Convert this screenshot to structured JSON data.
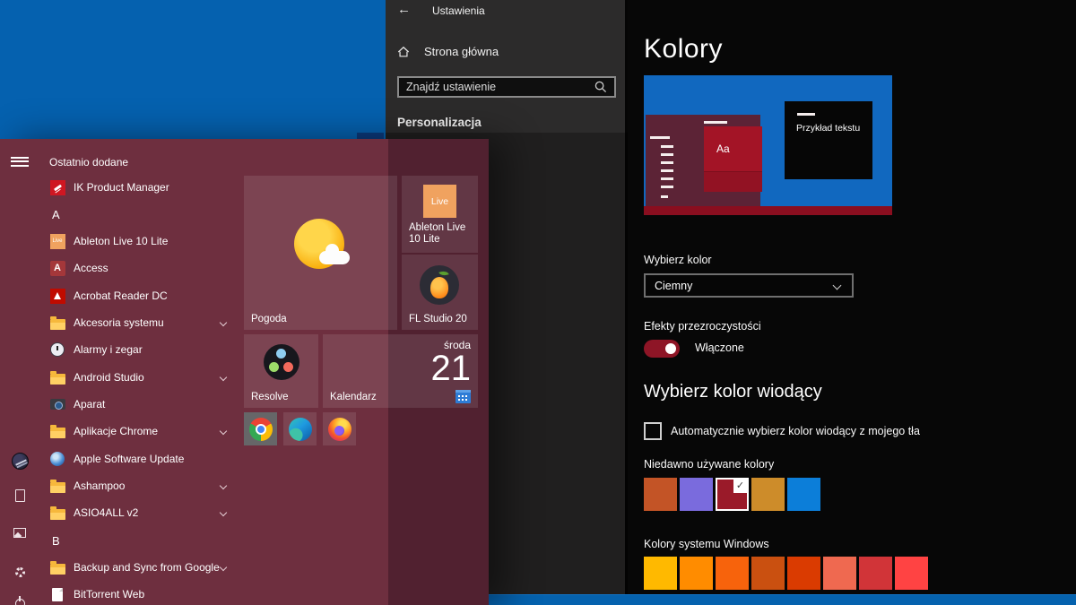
{
  "desktop": {
    "wallpaper_color": "#0561af",
    "taskbar_color": "#0562ae"
  },
  "settings_sidebar": {
    "back_arrow": "←",
    "title": "Ustawienia",
    "home_label": "Strona główna",
    "search_placeholder": "Znajdź ustawienie",
    "section_header": "Personalizacja"
  },
  "colors_page": {
    "title": "Kolory",
    "preview": {
      "aa": "Aa",
      "sample_text": "Przykład tekstu"
    },
    "choose_color_label": "Wybierz kolor",
    "choose_color_value": "Ciemny",
    "transparency_label": "Efekty przezroczystości",
    "transparency_state": "Włączone",
    "accent_header": "Wybierz kolor wiodący",
    "auto_checkbox_label": "Automatycznie wybierz kolor wiodący z mojego tła",
    "recent_colors_label": "Niedawno używane kolory",
    "recent_colors": [
      "#c35426",
      "#7a6bdd",
      "#9a1a29",
      "#cd8c2a",
      "#0c7ed9"
    ],
    "selected_recent_index": 2,
    "system_colors_label": "Kolory systemu Windows",
    "system_colors": [
      "#ffb900",
      "#ff8c00",
      "#f7630c",
      "#ca5010",
      "#da3b01",
      "#ef6950",
      "#d13438",
      "#ff4343"
    ],
    "accent_color": "#8e1526"
  },
  "start_menu": {
    "recent_header": "Ostatnio dodane",
    "apps": [
      {
        "label": "IK Product Manager"
      },
      {
        "label": "A"
      },
      {
        "label": "Ableton Live 10 Lite"
      },
      {
        "label": "Access"
      },
      {
        "label": "Acrobat Reader DC"
      },
      {
        "label": "Akcesoria systemu"
      },
      {
        "label": "Alarmy i zegar"
      },
      {
        "label": "Android Studio"
      },
      {
        "label": "Aparat"
      },
      {
        "label": "Aplikacje Chrome"
      },
      {
        "label": "Apple Software Update"
      },
      {
        "label": "Ashampoo"
      },
      {
        "label": "ASIO4ALL v2"
      },
      {
        "label": "B"
      },
      {
        "label": "Backup and Sync from Google"
      },
      {
        "label": "BitTorrent Web"
      }
    ],
    "tiles": {
      "pogoda": "Pogoda",
      "ableton": {
        "badge": "Live",
        "label": "Ableton Live 10 Lite"
      },
      "fl_studio": "FL Studio 20",
      "resolve": "Resolve",
      "kalendarz": {
        "label": "Kalendarz",
        "day": "środa",
        "date": "21"
      }
    },
    "list_icon_a": "A"
  }
}
